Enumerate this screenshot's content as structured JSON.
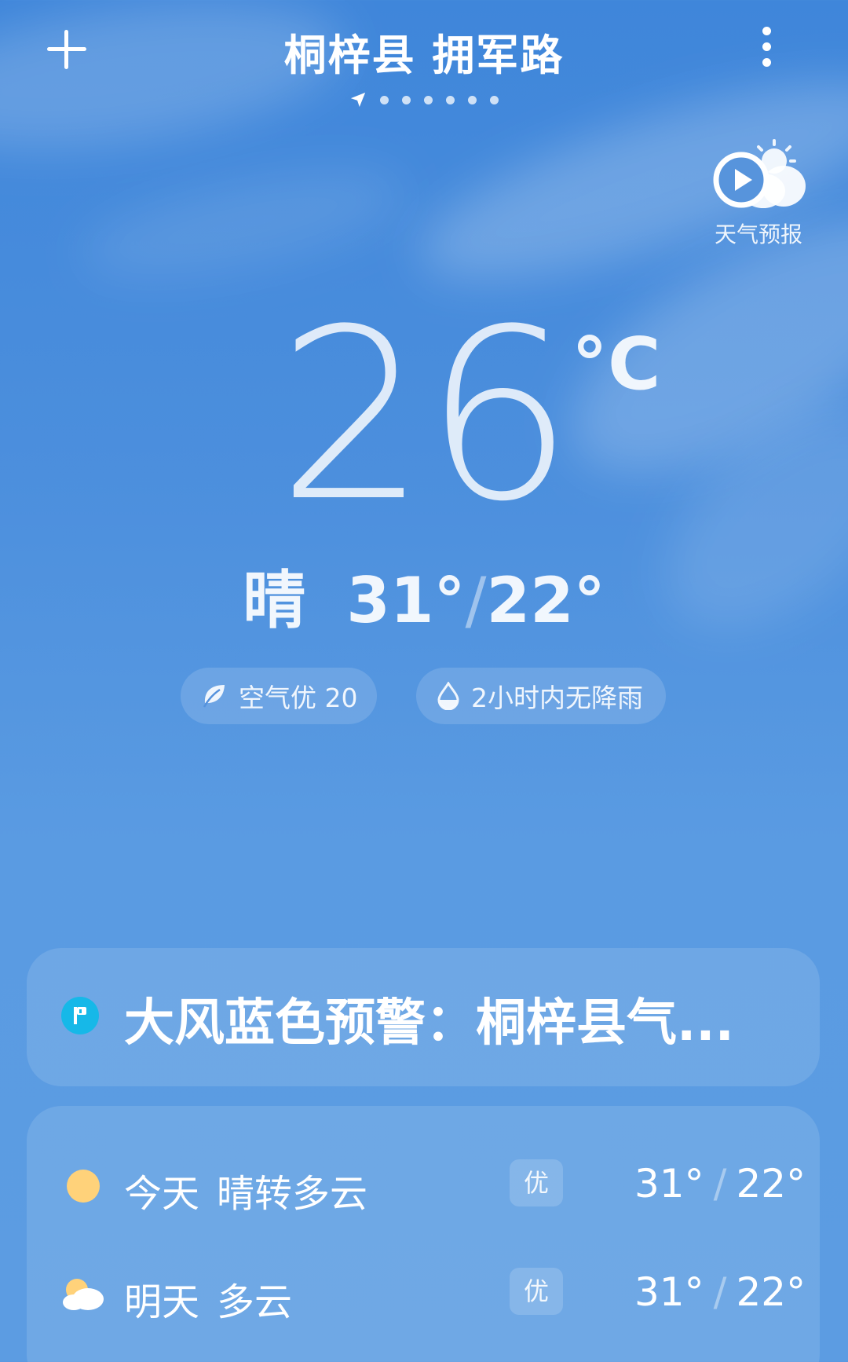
{
  "header": {
    "city": "桐梓县 拥军路",
    "add_icon": "plus-icon",
    "more_icon": "more-vertical-icon",
    "page_dot_count": 6
  },
  "forecast_video": {
    "label": "天气预报",
    "icon": "play-cloud-sun-icon"
  },
  "current": {
    "temperature": "26",
    "unit": "°C",
    "condition": "晴",
    "high": "31°",
    "low": "22°"
  },
  "chips": {
    "aqi": {
      "icon": "leaf-icon",
      "label": "空气优 20"
    },
    "rain": {
      "icon": "water-drop-icon",
      "label": "2小时内无降雨"
    }
  },
  "alert": {
    "icon": "warning-badge-icon",
    "text": "大风蓝色预警：桐梓县气..."
  },
  "daily": [
    {
      "icon": "sun-icon",
      "day": "今天",
      "condition": "晴转多云",
      "aqi": "优",
      "high": "31°",
      "low": "22°"
    },
    {
      "icon": "cloudy-icon",
      "day": "明天",
      "condition": "多云",
      "aqi": "优",
      "high": "31°",
      "low": "22°"
    }
  ],
  "colors": {
    "sky_top": "#3f86da",
    "sky_bottom": "#5c9ce2",
    "alert_badge": "#16b8e8",
    "sun": "#ffd27a"
  }
}
